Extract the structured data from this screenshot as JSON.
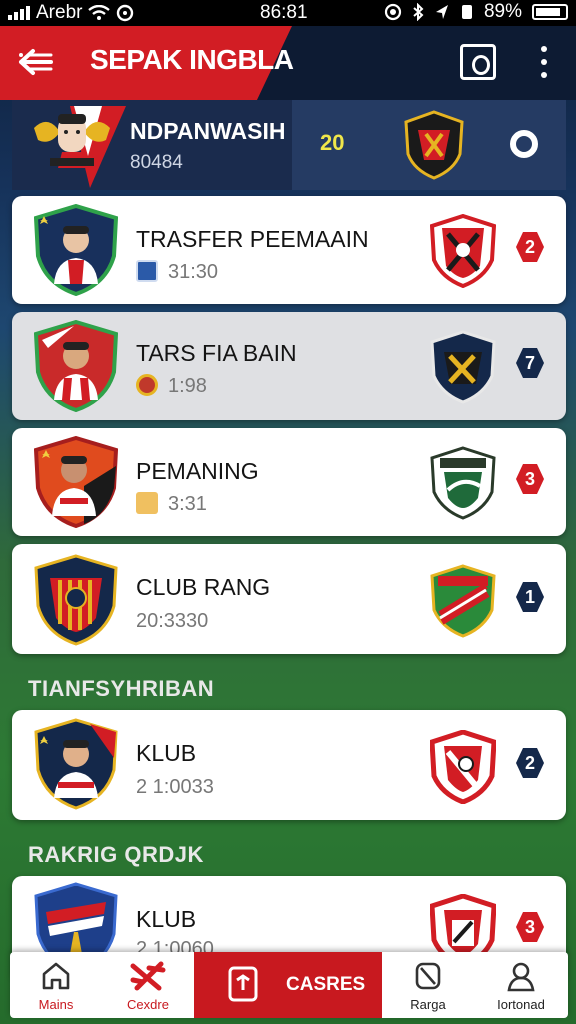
{
  "status_bar": {
    "carrier": "Arebr",
    "time": "86:81",
    "battery": "89%"
  },
  "app_bar": {
    "title": "SEPAK INGBLA",
    "colors": {
      "primary": "#d21d24",
      "dark": "#0d1b33"
    }
  },
  "hero": {
    "name": "NDPANWASIH",
    "code": "80484",
    "score": "20"
  },
  "items": [
    {
      "name": "TRASFER PEEMAAIN",
      "sub": "31:30",
      "rank": "2",
      "rank_color": "red"
    },
    {
      "name": "TARS FIA BAIN",
      "sub": "1:98",
      "rank": "7",
      "rank_color": "navy"
    },
    {
      "name": "PEMANING",
      "sub": "3:31",
      "rank": "3",
      "rank_color": "red"
    },
    {
      "name": "CLUB RANG",
      "sub": "20:3330",
      "rank": "1",
      "rank_color": "navy"
    }
  ],
  "sections": {
    "transfer_title": "TIANFSYHRIBAN",
    "ranking_title": "RAKRIG QRDJK"
  },
  "transfer_items": [
    {
      "name": "KLUB",
      "sub": "2 1:0033",
      "rank": "2",
      "rank_color": "navy"
    }
  ],
  "ranking_items": [
    {
      "name": "KLUB",
      "sub": "2 1:0060",
      "rank": "3",
      "rank_color": "red"
    }
  ],
  "bottom_nav": {
    "items": [
      {
        "label": "Mains",
        "icon": "home-icon"
      },
      {
        "label": "Cexdre",
        "icon": "cross-icon"
      },
      {
        "label": "CASRES",
        "icon": "document-icon",
        "active": true
      },
      {
        "label": "Rarga",
        "icon": "tag-icon"
      },
      {
        "label": "Iortonad",
        "icon": "profile-icon"
      }
    ]
  }
}
